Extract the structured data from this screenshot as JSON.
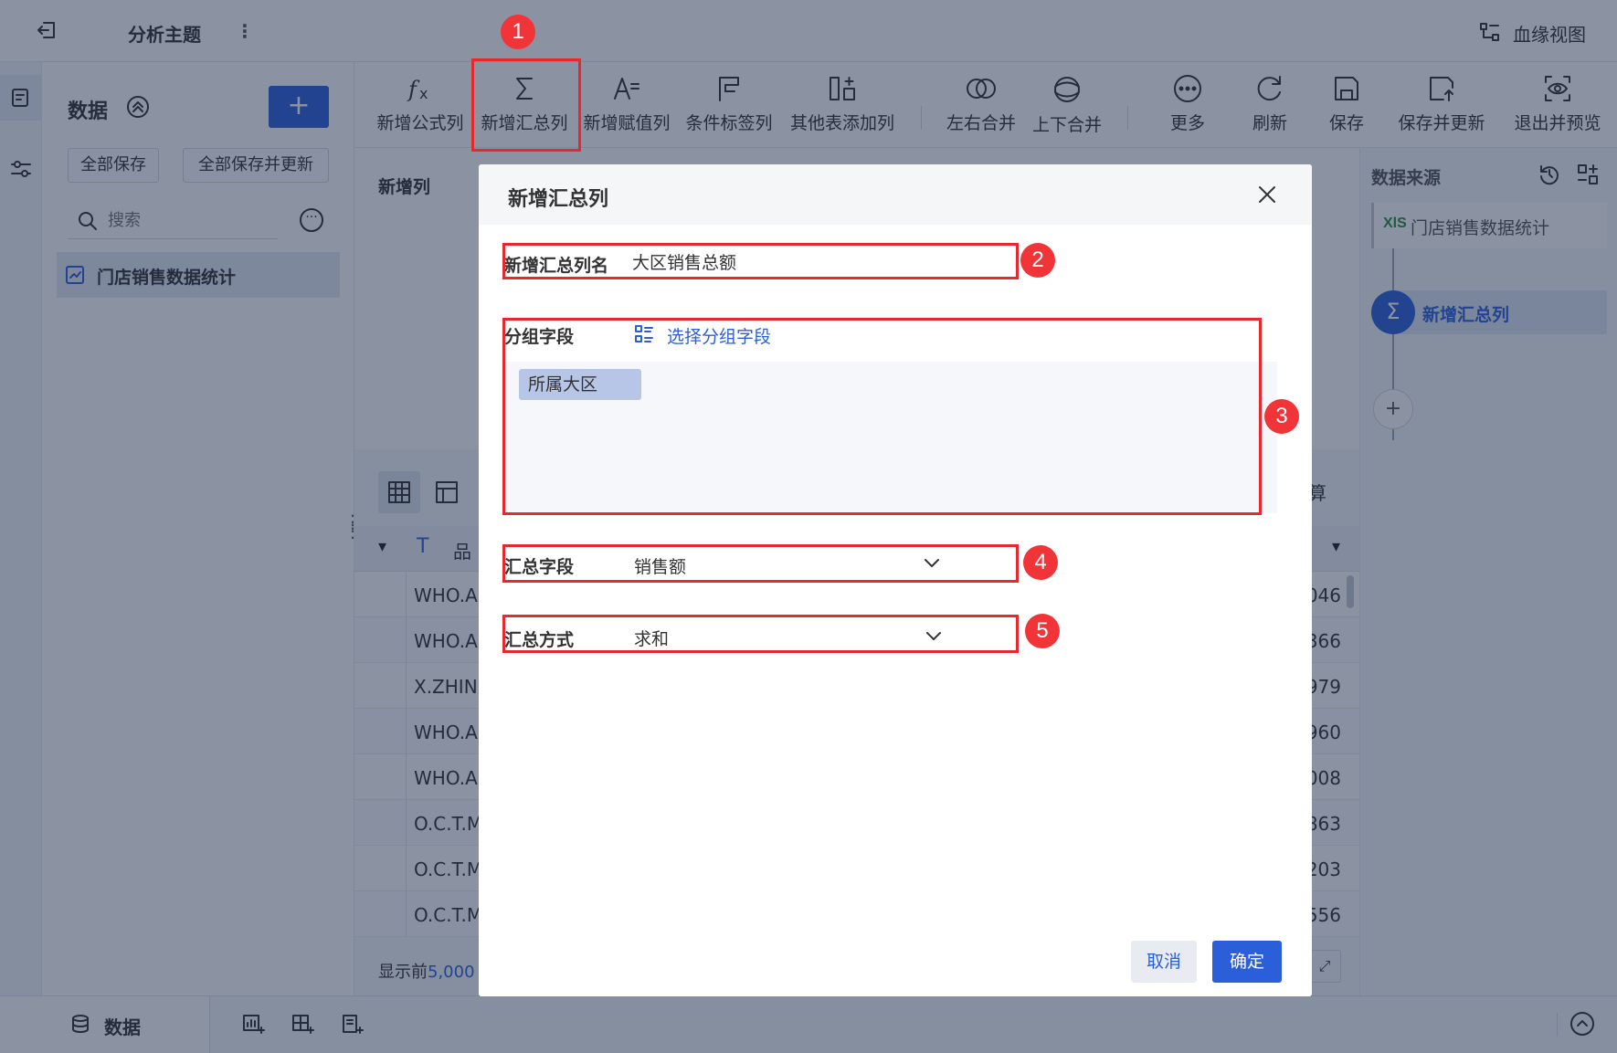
{
  "topbar": {
    "title": "分析主题",
    "lineage_label": "血缘视图"
  },
  "left_panel": {
    "title": "数据",
    "add_button": "+",
    "save_all": "全部保存",
    "save_all_update": "全部保存并更新",
    "search_placeholder": "搜索",
    "items": [
      {
        "label": "门店销售数据统计"
      }
    ]
  },
  "toolbar": {
    "items": [
      {
        "label": "新增公式列",
        "icon": "fx-icon"
      },
      {
        "label": "新增汇总列",
        "icon": "sigma-icon"
      },
      {
        "label": "新增赋值列",
        "icon": "assign-icon"
      },
      {
        "label": "条件标签列",
        "icon": "flag-icon"
      },
      {
        "label": "其他表添加列",
        "icon": "add-column-icon"
      },
      {
        "label": "左右合并",
        "icon": "merge-horizontal-icon"
      },
      {
        "label": "上下合并",
        "icon": "merge-vertical-icon"
      },
      {
        "label": "更多",
        "icon": "more-icon"
      },
      {
        "label": "刷新",
        "icon": "refresh-icon"
      },
      {
        "label": "保存",
        "icon": "save-icon"
      },
      {
        "label": "保存并更新",
        "icon": "save-update-icon"
      },
      {
        "label": "退出并预览",
        "icon": "preview-icon"
      }
    ]
  },
  "center": {
    "section_label": "新增列",
    "partial_right_label": "算",
    "table": {
      "header_type_icon": "T",
      "header_partial": "品",
      "rows": [
        {
          "left": "WHO.A.",
          "right": "046"
        },
        {
          "left": "WHO.A.",
          "right": "366"
        },
        {
          "left": "X.ZHINI",
          "right": "979"
        },
        {
          "left": "WHO.A.",
          "right": "960"
        },
        {
          "left": "WHO.A.",
          "right": "008"
        },
        {
          "left": "O.C.T.M",
          "right": "863"
        },
        {
          "left": "O.C.T.M",
          "right": "203"
        },
        {
          "left": "O.C.T.M",
          "right": "556"
        }
      ]
    },
    "footer_prefix": "显示前",
    "footer_count": "5,000"
  },
  "right_panel": {
    "title": "数据来源",
    "source_badge": "XlS",
    "source_label": "门店销售数据统计",
    "step_label": "新增汇总列",
    "add_step": "+"
  },
  "bottombar": {
    "tab_label": "数据"
  },
  "modal": {
    "title": "新增汇总列",
    "name_label": "新增汇总列名",
    "name_value": "大区销售总额",
    "group_label": "分组字段",
    "group_select_label": "选择分组字段",
    "group_tags": [
      "所属大区"
    ],
    "agg_field_label": "汇总字段",
    "agg_field_value": "销售额",
    "agg_method_label": "汇总方式",
    "agg_method_value": "求和",
    "cancel": "取消",
    "confirm": "确定"
  },
  "annotations": [
    "1",
    "2",
    "3",
    "4",
    "5"
  ],
  "colors": {
    "primary": "#2b5fd9",
    "annotation_red": "#e5292e",
    "overlay": "#182848"
  }
}
